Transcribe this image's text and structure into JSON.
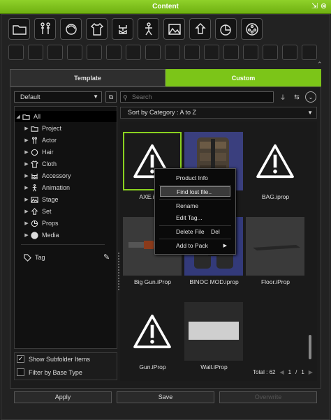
{
  "window": {
    "title": "Content",
    "pin_glyph": "⇲",
    "close_glyph": "⊗"
  },
  "categories": [
    "folder-icon",
    "actor-icon",
    "hair-icon",
    "cloth-icon",
    "accessory-icon",
    "animation-icon",
    "stage-icon",
    "set-icon",
    "props-icon",
    "media-icon"
  ],
  "tabs": {
    "template": "Template",
    "custom": "Custom"
  },
  "toolbar": {
    "dropdown_value": "Default",
    "search_placeholder": "Search"
  },
  "tree": {
    "root": "All",
    "items": [
      "Project",
      "Actor",
      "Hair",
      "Cloth",
      "Accessory",
      "Animation",
      "Stage",
      "Set",
      "Props",
      "Media"
    ],
    "tag": "Tag"
  },
  "sort": {
    "label": "Sort by Category : A to Z"
  },
  "items": [
    {
      "label": "AXE.iprop",
      "kind": "missing"
    },
    {
      "label": "",
      "kind": "pack"
    },
    {
      "label": "BAG.iprop",
      "kind": "missing"
    },
    {
      "label": "Big Gun.iProp",
      "kind": "gun"
    },
    {
      "label": "BINOC MOD.iprop",
      "kind": "binoc"
    },
    {
      "label": "Floor.iProp",
      "kind": "floor"
    },
    {
      "label": "Gun.iProp",
      "kind": "missing"
    },
    {
      "label": "Wall.iProp",
      "kind": "wall"
    }
  ],
  "context_menu": {
    "product_info": "Product Info",
    "find_lost": "Find lost file..",
    "rename": "Rename",
    "edit_tag": "Edit Tag...",
    "delete": "Delete File",
    "delete_shortcut": "Del",
    "add_to_pack": "Add to Pack"
  },
  "pager": {
    "total": "Total : 62",
    "page": "1",
    "sep": "/",
    "pages": "1"
  },
  "options": {
    "show_subfolder": "Show Subfolder Items",
    "filter_base": "Filter by Base Type"
  },
  "buttons": {
    "apply": "Apply",
    "save": "Save",
    "overwrite": "Overwrite"
  },
  "colors": {
    "accent": "#7cc518"
  }
}
